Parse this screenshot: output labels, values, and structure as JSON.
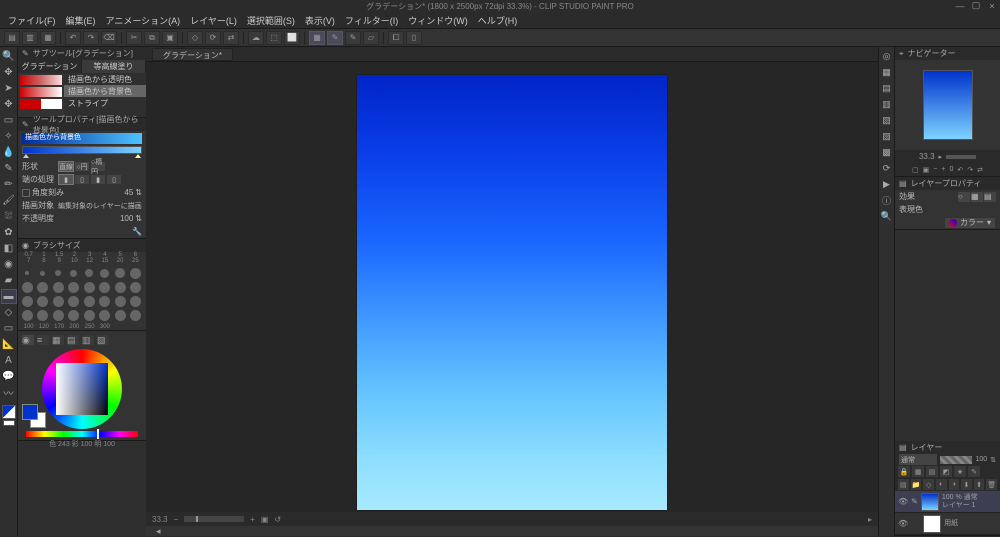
{
  "titlebar": {
    "document_title": "グラデーション* (1800 x 2500px 72dpi 33.3%) - CLIP STUDIO PAINT PRO"
  },
  "menu": {
    "items": [
      "ファイル(F)",
      "編集(E)",
      "アニメーション(A)",
      "レイヤー(L)",
      "選択範囲(S)",
      "表示(V)",
      "フィルター(I)",
      "ウィンドウ(W)",
      "ヘルプ(H)"
    ]
  },
  "subtool_panel": {
    "title": "サブツール[グラデーション]",
    "tabs": [
      "グラデーション",
      "等高線塗り"
    ],
    "items": [
      "描画色から透明色",
      "描画色から背景色",
      "ストライプ"
    ]
  },
  "tool_property": {
    "title": "ツールプロパティ[描画色から背景色]",
    "gradient_name": "描画色から背景色",
    "rows": {
      "shape_label": "形状",
      "shape_opts": [
        "直線",
        "○円",
        "○楕円"
      ],
      "edge_label": "端の処理",
      "angle_label": "角度刻み",
      "angle_val": "45",
      "target_label": "描画対象",
      "target_val": "編集対象のレイヤーに描画",
      "opacity_label": "不透明度",
      "opacity_val": "100"
    }
  },
  "brush_size": {
    "title": "ブラシサイズ",
    "labels1": [
      "0.7",
      "1",
      "1.5",
      "2",
      "3",
      "4",
      "5",
      "6"
    ],
    "labels2": [
      "7",
      "8",
      "9",
      "10",
      "12",
      "15",
      "20",
      "25"
    ],
    "labels3": [
      "100",
      "120",
      "170",
      "200",
      "250",
      "300"
    ]
  },
  "color_panel": {
    "readout": "色 243 彩 100 明 100"
  },
  "canvas": {
    "tab": "グラデーション*",
    "zoom": "33.3",
    "status_extra": "↺"
  },
  "navigator": {
    "title": "ナビゲーター",
    "zoom": "33.3",
    "angle": "0"
  },
  "layer_property": {
    "title": "レイヤープロパティ",
    "effect_label": "効果",
    "expr_label": "表現色",
    "expr_value": "カラー"
  },
  "layer_panel": {
    "title": "レイヤー",
    "blend_mode": "通常",
    "opacity": "100",
    "layers": [
      {
        "mode": "100 % 通常",
        "name": "レイヤー 1"
      },
      {
        "mode": "",
        "name": "用紙"
      }
    ]
  }
}
